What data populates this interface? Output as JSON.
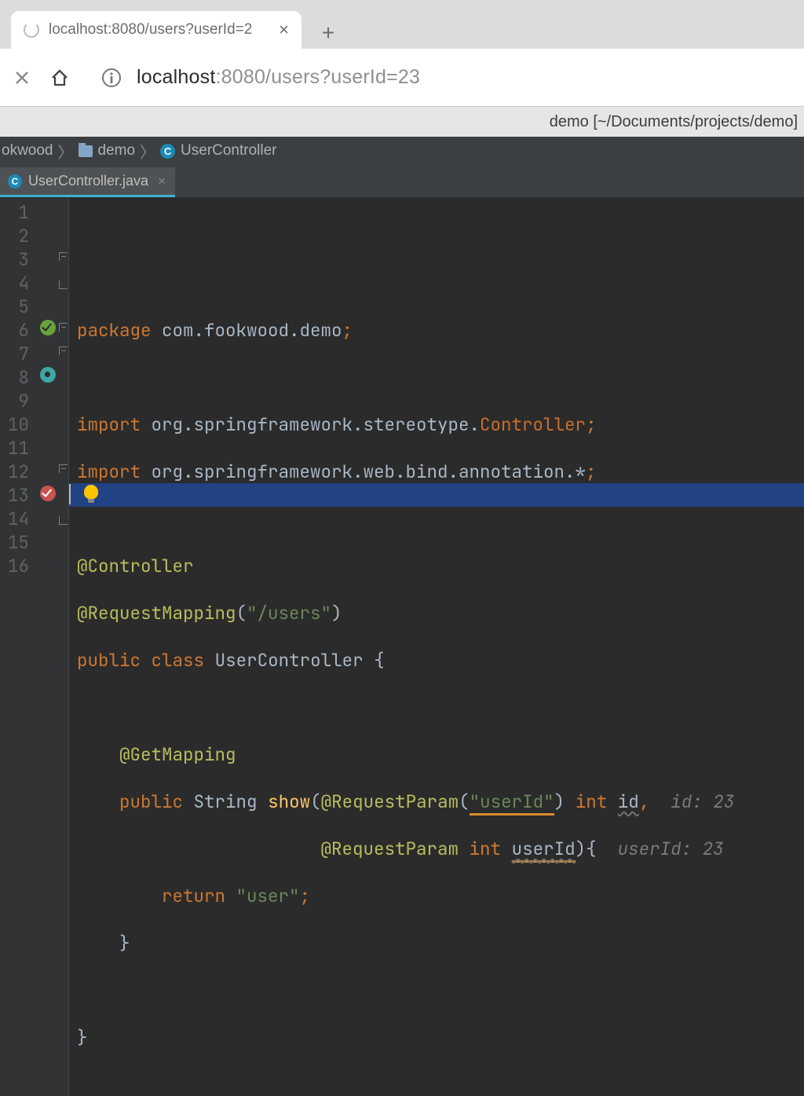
{
  "browser": {
    "tab_title": "localhost:8080/users?userId=2",
    "url_host": "localhost",
    "url_port_path": ":8080/users?userId=23"
  },
  "ide": {
    "window_title": "demo [~/Documents/projects/demo]",
    "breadcrumbs": {
      "root": "okwood",
      "folder": "demo",
      "class": "UserController"
    },
    "file_tab": "UserController.java",
    "code": {
      "l1_kw": "package",
      "l1_pkg": "com.fookwood.demo",
      "l3_kw": "import",
      "l3_pkg": "org.springframework.stereotype.",
      "l3_cls": "Controller",
      "l4_kw": "import",
      "l4_pkg": "org.springframework.web.bind.annotation.*",
      "l6_ann": "@Controller",
      "l7_ann": "@RequestMapping",
      "l7_str": "\"/users\"",
      "l8_pub": "public",
      "l8_cls": "class",
      "l8_name": "UserController",
      "l10_ann": "@GetMapping",
      "l11_pub": "public",
      "l11_ret": "String",
      "l11_mth": "show",
      "l11_ann": "@RequestParam",
      "l11_str": "\"userId\"",
      "l11_int": "int",
      "l11_id": "id",
      "l11_cmt": "id: 23",
      "l12_ann": "@RequestParam",
      "l12_int": "int",
      "l12_id": "userId",
      "l12_cmt": "userId: 23",
      "l13_ret": "return",
      "l13_str": "\"user\""
    },
    "line_numbers": [
      "1",
      "2",
      "3",
      "4",
      "5",
      "6",
      "7",
      "8",
      "9",
      "10",
      "11",
      "12",
      "13",
      "14",
      "15",
      "16"
    ]
  }
}
